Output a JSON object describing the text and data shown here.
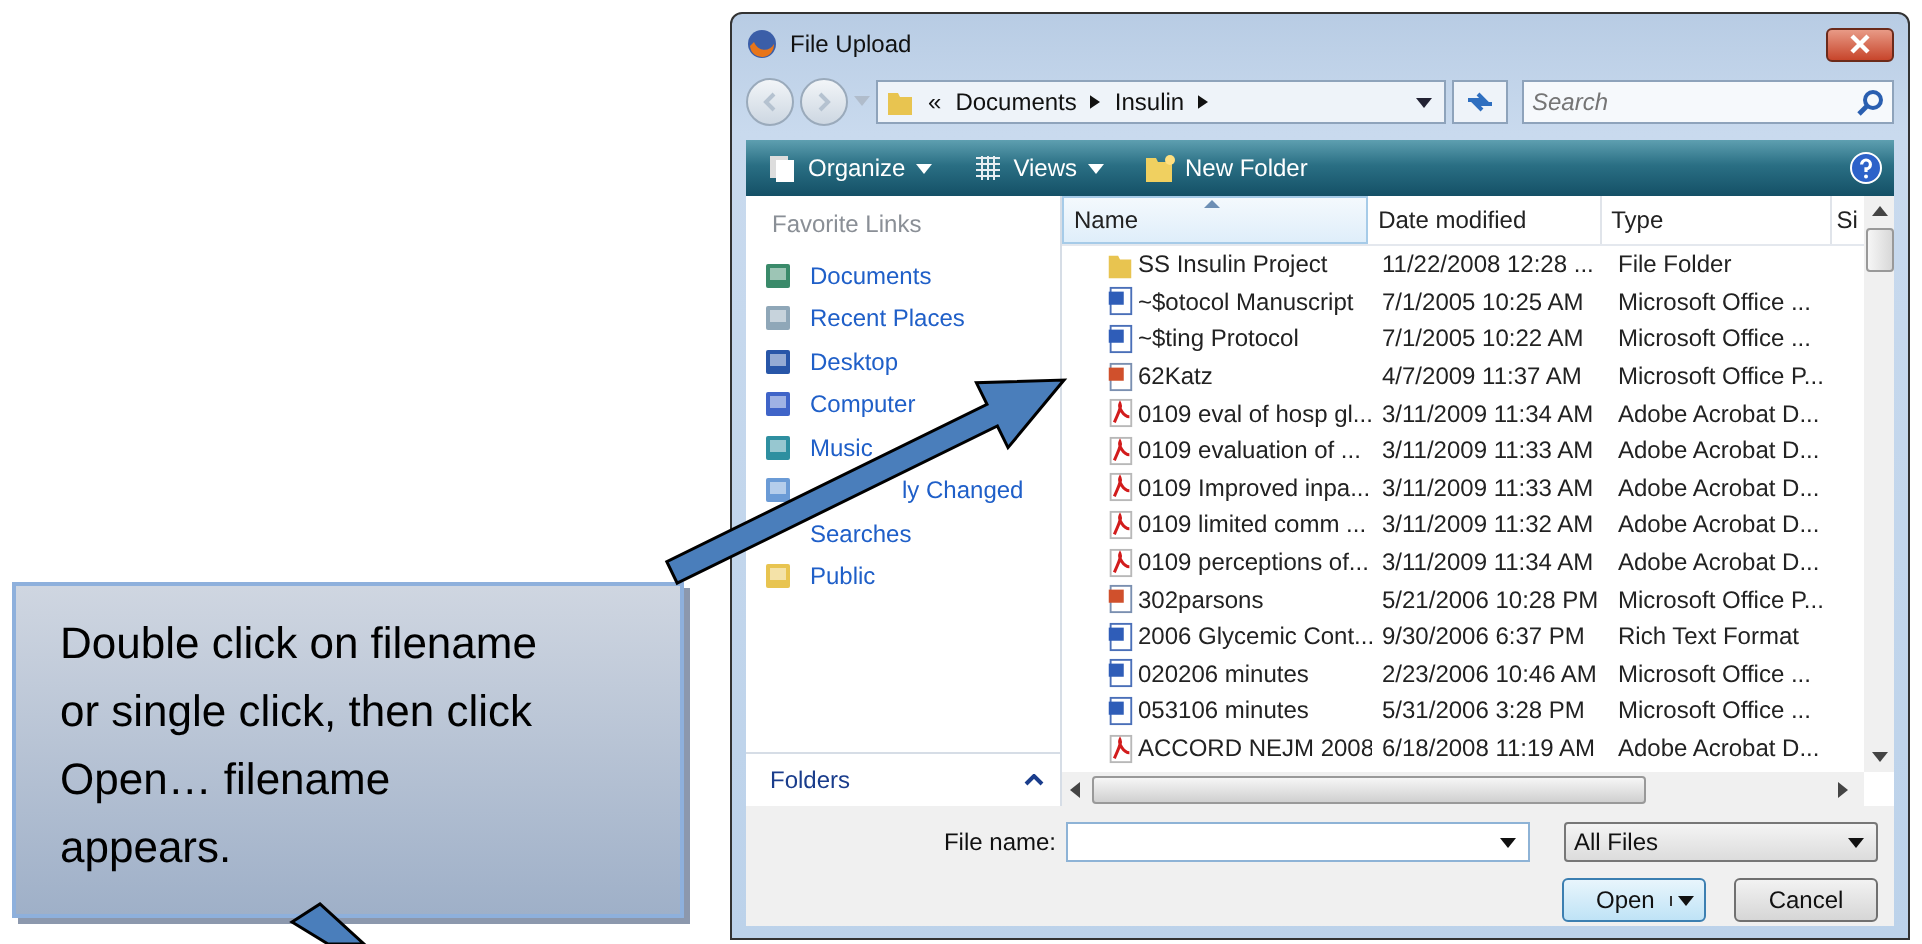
{
  "window": {
    "title": "File Upload"
  },
  "address": {
    "overflow": "«",
    "crumbs": [
      "Documents",
      "Insulin"
    ]
  },
  "search": {
    "placeholder": "Search"
  },
  "toolbar": [
    {
      "label": "Organize",
      "kind": "menu"
    },
    {
      "label": "Views",
      "kind": "menu"
    },
    {
      "label": "New Folder",
      "kind": "button"
    }
  ],
  "sidebar": {
    "heading": "Favorite Links",
    "items": [
      {
        "label": "Documents",
        "kind": "documents"
      },
      {
        "label": "Recent Places",
        "kind": "places"
      },
      {
        "label": "Desktop",
        "kind": "desktop"
      },
      {
        "label": "Computer",
        "kind": "computer"
      },
      {
        "label": "Music",
        "kind": "music"
      },
      {
        "label": "ly Changed",
        "kind": "recent",
        "covered": true
      },
      {
        "label": "Searches",
        "icon_covered": true
      },
      {
        "label": "Public",
        "kind": "folder"
      }
    ],
    "footer": "Folders"
  },
  "table": {
    "columns": [
      {
        "label": "Name",
        "sorted": true
      },
      {
        "label": "Date modified",
        "sorted": false
      },
      {
        "label": "Type",
        "sorted": false
      },
      {
        "label": "Si",
        "sorted": false
      }
    ],
    "rows": [
      {
        "kind": "folder",
        "name": "SS Insulin Project",
        "date": "11/22/2008 12:28 ...",
        "type": "File Folder"
      },
      {
        "kind": "word",
        "name": "~$otocol Manuscript",
        "date": "7/1/2005 10:25 AM",
        "type": "Microsoft Office ..."
      },
      {
        "kind": "word",
        "name": "~$ting Protocol",
        "date": "7/1/2005 10:22 AM",
        "type": "Microsoft Office ..."
      },
      {
        "kind": "ppt",
        "name": "62Katz",
        "date": "4/7/2009 11:37 AM",
        "type": "Microsoft Office P..."
      },
      {
        "kind": "pdf",
        "name": "0109 eval of hosp gl...",
        "date": "3/11/2009 11:34 AM",
        "type": "Adobe Acrobat D..."
      },
      {
        "kind": "pdf",
        "name": "0109 evaluation of ...",
        "date": "3/11/2009 11:33 AM",
        "type": "Adobe Acrobat D..."
      },
      {
        "kind": "pdf",
        "name": "0109 Improved inpa...",
        "date": "3/11/2009 11:33 AM",
        "type": "Adobe Acrobat D..."
      },
      {
        "kind": "pdf",
        "name": "0109 limited comm ...",
        "date": "3/11/2009 11:32 AM",
        "type": "Adobe Acrobat D..."
      },
      {
        "kind": "pdf",
        "name": "0109 perceptions of...",
        "date": "3/11/2009 11:34 AM",
        "type": "Adobe Acrobat D..."
      },
      {
        "kind": "ppt",
        "name": "302parsons",
        "date": "5/21/2006 10:28 PM",
        "type": "Microsoft Office P..."
      },
      {
        "kind": "word",
        "name": "2006 Glycemic Cont...",
        "date": "9/30/2006 6:37 PM",
        "type": "Rich Text Format"
      },
      {
        "kind": "word",
        "name": "020206 minutes",
        "date": "2/23/2006 10:46 AM",
        "type": "Microsoft Office ..."
      },
      {
        "kind": "word",
        "name": "053106 minutes",
        "date": "5/31/2006 3:28 PM",
        "type": "Microsoft Office ..."
      },
      {
        "kind": "pdf",
        "name": "ACCORD NEJM 2008",
        "date": "6/18/2008 11:19 AM",
        "type": "Adobe Acrobat D..."
      }
    ]
  },
  "file_name": {
    "label": "File name:"
  },
  "file_type": {
    "value": "All Files"
  },
  "buttons": [
    {
      "label": "Open",
      "kind": "split"
    },
    {
      "label": "Cancel",
      "kind": "plain"
    }
  ],
  "callout": {
    "text": "Double click on filename or single click, then click Open… filename appears."
  }
}
